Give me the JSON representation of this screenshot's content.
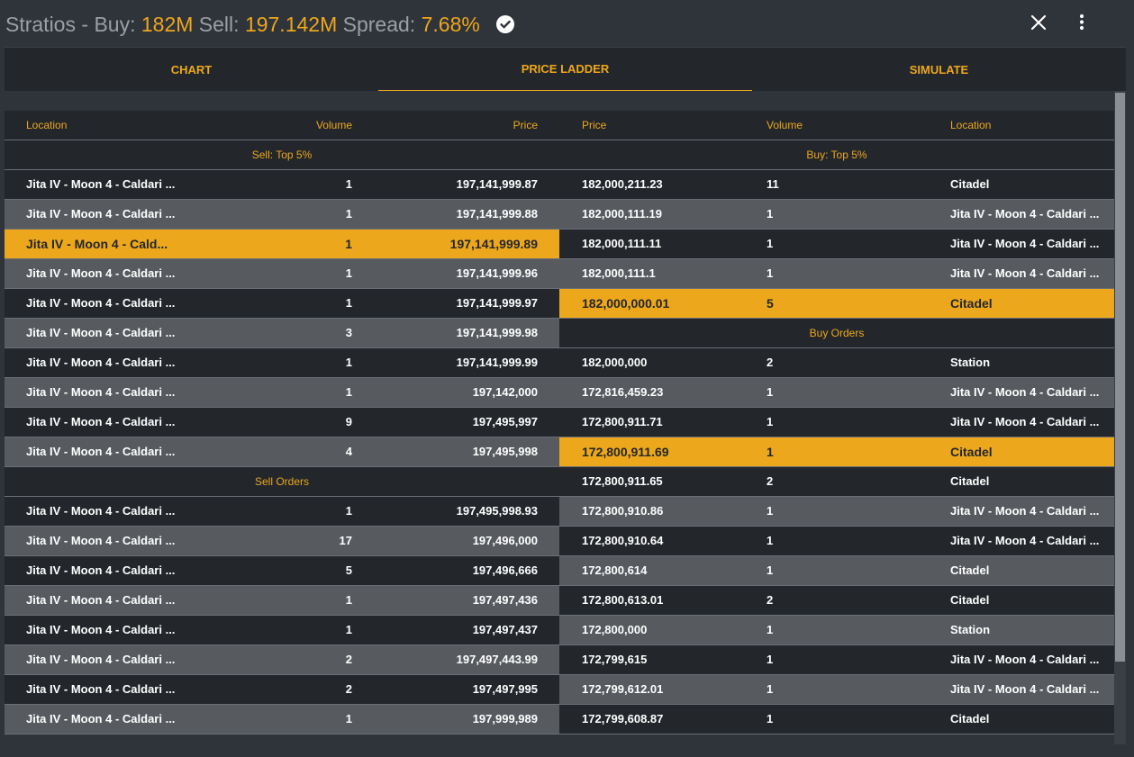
{
  "header": {
    "item": "Stratios",
    "buy_label": "Buy:",
    "buy_value": "182M",
    "sell_label": "Sell:",
    "sell_value": "197.142M",
    "spread_label": "Spread:",
    "spread_value": "7.68%",
    "icons": [
      "check-circle-icon",
      "close-icon",
      "more-vert-icon"
    ]
  },
  "tabs": [
    {
      "label": "CHART",
      "active": false
    },
    {
      "label": "PRICE LADDER",
      "active": true
    },
    {
      "label": "SIMULATE",
      "active": false
    }
  ],
  "columns": {
    "left": {
      "location": "Location",
      "volume": "Volume",
      "price": "Price"
    },
    "right": {
      "price": "Price",
      "volume": "Volume",
      "location": "Location"
    }
  },
  "left_rows": [
    {
      "section": "Sell: Top 5%"
    },
    {
      "location": "Jita IV - Moon 4 - Caldari ...",
      "volume": "1",
      "price": "197,141,999.87",
      "shade": "dark"
    },
    {
      "location": "Jita IV - Moon 4 - Caldari ...",
      "volume": "1",
      "price": "197,141,999.88",
      "shade": "light"
    },
    {
      "location": "Jita IV - Moon 4 - Cald...",
      "volume": "1",
      "price": "197,141,999.89",
      "shade": "dark",
      "highlight": true
    },
    {
      "location": "Jita IV - Moon 4 - Caldari ...",
      "volume": "1",
      "price": "197,141,999.96",
      "shade": "light"
    },
    {
      "location": "Jita IV - Moon 4 - Caldari ...",
      "volume": "1",
      "price": "197,141,999.97",
      "shade": "dark"
    },
    {
      "location": "Jita IV - Moon 4 - Caldari ...",
      "volume": "3",
      "price": "197,141,999.98",
      "shade": "light"
    },
    {
      "location": "Jita IV - Moon 4 - Caldari ...",
      "volume": "1",
      "price": "197,141,999.99",
      "shade": "dark"
    },
    {
      "location": "Jita IV - Moon 4 - Caldari ...",
      "volume": "1",
      "price": "197,142,000",
      "shade": "light"
    },
    {
      "location": "Jita IV - Moon 4 - Caldari ...",
      "volume": "9",
      "price": "197,495,997",
      "shade": "dark"
    },
    {
      "location": "Jita IV - Moon 4 - Caldari ...",
      "volume": "4",
      "price": "197,495,998",
      "shade": "light"
    },
    {
      "section": "Sell Orders"
    },
    {
      "location": "Jita IV - Moon 4 - Caldari ...",
      "volume": "1",
      "price": "197,495,998.93",
      "shade": "dark"
    },
    {
      "location": "Jita IV - Moon 4 - Caldari ...",
      "volume": "17",
      "price": "197,496,000",
      "shade": "light"
    },
    {
      "location": "Jita IV - Moon 4 - Caldari ...",
      "volume": "5",
      "price": "197,496,666",
      "shade": "dark"
    },
    {
      "location": "Jita IV - Moon 4 - Caldari ...",
      "volume": "1",
      "price": "197,497,436",
      "shade": "light"
    },
    {
      "location": "Jita IV - Moon 4 - Caldari ...",
      "volume": "1",
      "price": "197,497,437",
      "shade": "dark"
    },
    {
      "location": "Jita IV - Moon 4 - Caldari ...",
      "volume": "2",
      "price": "197,497,443.99",
      "shade": "light"
    },
    {
      "location": "Jita IV - Moon 4 - Caldari ...",
      "volume": "2",
      "price": "197,497,995",
      "shade": "dark"
    },
    {
      "location": "Jita IV - Moon 4 - Caldari ...",
      "volume": "1",
      "price": "197,999,989",
      "shade": "light"
    }
  ],
  "right_rows": [
    {
      "section": "Buy: Top 5%"
    },
    {
      "price": "182,000,211.23",
      "volume": "11",
      "location": "Citadel",
      "shade": "dark"
    },
    {
      "price": "182,000,111.19",
      "volume": "1",
      "location": "Jita IV - Moon 4 - Caldari ...",
      "shade": "light"
    },
    {
      "price": "182,000,111.11",
      "volume": "1",
      "location": "Jita IV - Moon 4 - Caldari ...",
      "shade": "dark"
    },
    {
      "price": "182,000,111.1",
      "volume": "1",
      "location": "Jita IV - Moon 4 - Caldari ...",
      "shade": "light"
    },
    {
      "price": "182,000,000.01",
      "volume": "5",
      "location": "Citadel",
      "shade": "dark",
      "highlight": true
    },
    {
      "section": "Buy Orders"
    },
    {
      "price": "182,000,000",
      "volume": "2",
      "location": "Station",
      "shade": "dark"
    },
    {
      "price": "172,816,459.23",
      "volume": "1",
      "location": "Jita IV - Moon 4 - Caldari ...",
      "shade": "light"
    },
    {
      "price": "172,800,911.71",
      "volume": "1",
      "location": "Jita IV - Moon 4 - Caldari ...",
      "shade": "dark"
    },
    {
      "price": "172,800,911.69",
      "volume": "1",
      "location": "Citadel",
      "shade": "light",
      "highlight": true
    },
    {
      "price": "172,800,911.65",
      "volume": "2",
      "location": "Citadel",
      "shade": "dark"
    },
    {
      "price": "172,800,910.86",
      "volume": "1",
      "location": "Jita IV - Moon 4 - Caldari ...",
      "shade": "light"
    },
    {
      "price": "172,800,910.64",
      "volume": "1",
      "location": "Jita IV - Moon 4 - Caldari ...",
      "shade": "dark"
    },
    {
      "price": "172,800,614",
      "volume": "1",
      "location": "Citadel",
      "shade": "light"
    },
    {
      "price": "172,800,613.01",
      "volume": "2",
      "location": "Citadel",
      "shade": "dark"
    },
    {
      "price": "172,800,000",
      "volume": "1",
      "location": "Station",
      "shade": "light"
    },
    {
      "price": "172,799,615",
      "volume": "1",
      "location": "Jita IV - Moon 4 - Caldari ...",
      "shade": "dark"
    },
    {
      "price": "172,799,612.01",
      "volume": "1",
      "location": "Jita IV - Moon 4 - Caldari ...",
      "shade": "light"
    },
    {
      "price": "172,799,608.87",
      "volume": "1",
      "location": "Citadel",
      "shade": "dark"
    }
  ],
  "colors": {
    "accent": "#eda71c",
    "dark_row": "#23272c",
    "light_row": "#575b60",
    "background": "#2f333a"
  }
}
